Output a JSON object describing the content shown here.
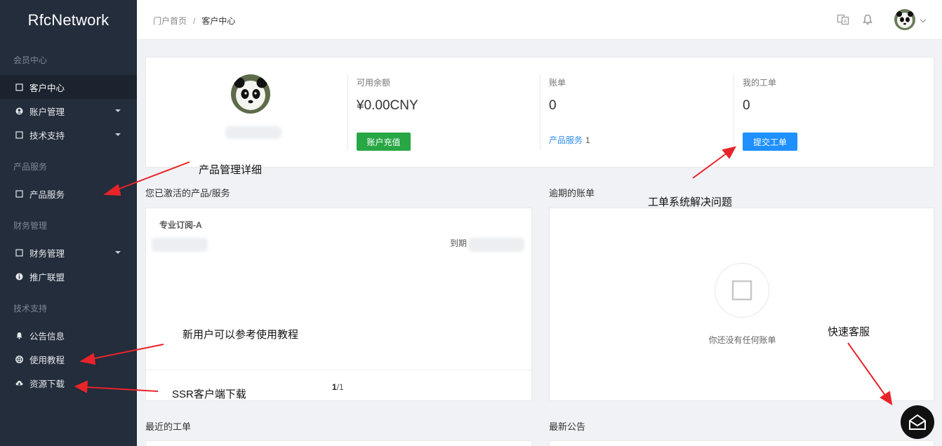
{
  "brand": "RfcNetwork",
  "sidebar": {
    "sections": [
      "会员中心",
      "产品服务",
      "财务管理",
      "技术支持"
    ],
    "items": [
      {
        "label": "客户中心",
        "icon": "square-icon"
      },
      {
        "label": "账户管理",
        "icon": "user-circle-icon"
      },
      {
        "label": "技术支持",
        "icon": "square-icon"
      },
      {
        "label": "产品服务",
        "icon": "square-icon"
      },
      {
        "label": "财务管理",
        "icon": "square-icon"
      },
      {
        "label": "推广联盟",
        "icon": "info-circle-icon"
      },
      {
        "label": "公告信息",
        "icon": "bell-icon"
      },
      {
        "label": "使用教程",
        "icon": "lifebuoy-icon"
      },
      {
        "label": "资源下载",
        "icon": "cloud-download-icon"
      }
    ]
  },
  "header": {
    "breadcrumb": {
      "home": "门户首页",
      "separator": "/",
      "current": "客户中心"
    }
  },
  "stats": {
    "balance": {
      "label": "可用余额",
      "value": "¥0.00CNY",
      "button": "账户充值"
    },
    "bills": {
      "label": "账单",
      "value": "0",
      "link": "产品服务",
      "link_count": "1"
    },
    "tickets": {
      "label": "我的工单",
      "value": "0",
      "button": "提交工单"
    }
  },
  "products": {
    "title": "您已激活的产品/服务",
    "item_name": "专业订阅-A",
    "expire_label": "到期",
    "pager_current": "1",
    "pager_total": "/1"
  },
  "overdue": {
    "title": "逾期的账单",
    "empty": "你还没有任何账单"
  },
  "recent_tickets": {
    "title": "最近的工单"
  },
  "announcements": {
    "title": "最新公告"
  },
  "annotations": {
    "product_detail": "产品管理详细",
    "ticket_system": "工单系统解决问题",
    "tutorial": "新用户可以参考使用教程",
    "client_download": "SSR客户端下载",
    "quick_service": "快速客服"
  },
  "colors": {
    "sidebar": "#232d3b",
    "green": "#28a745",
    "blue": "#1e90ff",
    "arrow": "#e8242a"
  }
}
